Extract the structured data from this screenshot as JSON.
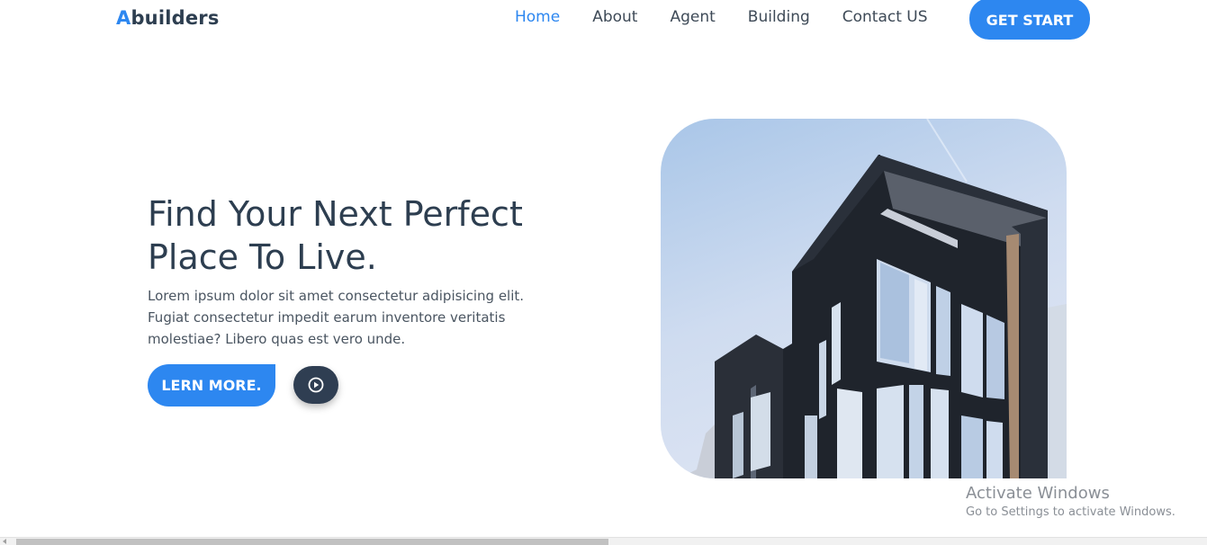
{
  "logo": {
    "accent_letter": "A",
    "rest": "builders"
  },
  "nav": {
    "items": [
      {
        "label": "Home",
        "active": true
      },
      {
        "label": "About",
        "active": false
      },
      {
        "label": "Agent",
        "active": false
      },
      {
        "label": "Building",
        "active": false
      },
      {
        "label": "Contact US",
        "active": false
      }
    ],
    "cta_label": "GET START"
  },
  "hero": {
    "title_line1": "Find Your Next Perfect",
    "title_line2": "Place To Live.",
    "text_line1": "Lorem ipsum dolor sit amet consectetur adipisicing elit.",
    "text_line2": "Fugiat consectetur impedit earum inventore veritatis",
    "text_line3": "molestiae? Libero quas est vero unde.",
    "learn_label": "LERN MORE.",
    "play_icon": "play-circle-icon"
  },
  "watermark": {
    "title": "Activate Windows",
    "subtitle": "Go to Settings to activate Windows."
  },
  "colors": {
    "accent": "#2d87f0",
    "heading": "#2d3e50",
    "play_bg": "#2f3e52"
  }
}
